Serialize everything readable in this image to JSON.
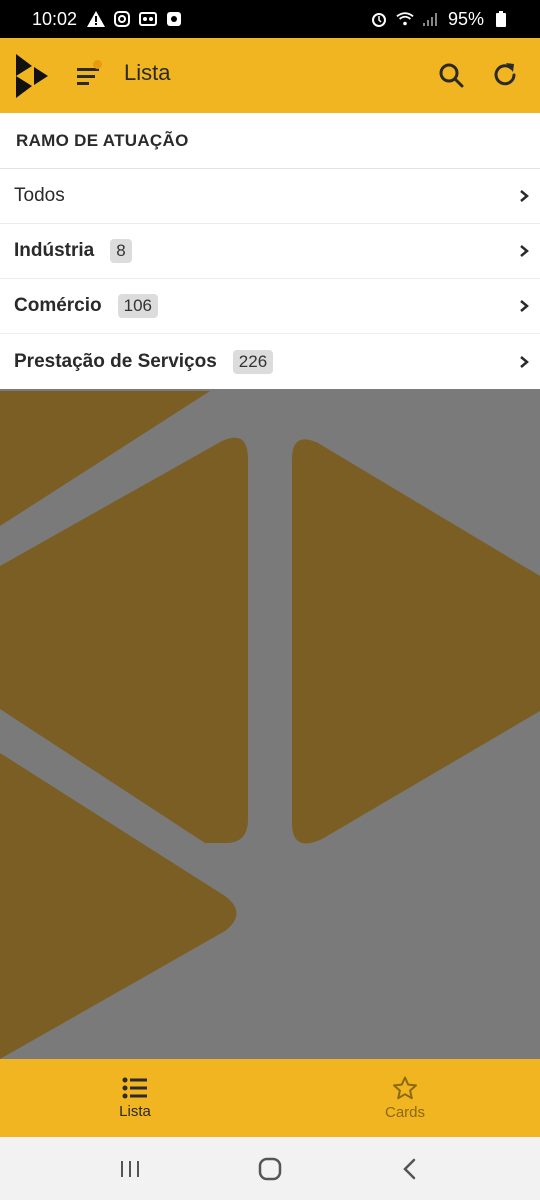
{
  "status_bar": {
    "time": "10:02",
    "battery": "95%"
  },
  "app_bar": {
    "title": "Lista",
    "icons": [
      "logo-icon",
      "menu-icon",
      "search-icon",
      "refresh-icon"
    ]
  },
  "section": {
    "header": "RAMO DE ATUAÇÃO",
    "items": [
      {
        "label": "Todos",
        "count": null
      },
      {
        "label": "Indústria",
        "count": "8"
      },
      {
        "label": "Comércio",
        "count": "106"
      },
      {
        "label": "Prestação de Serviços",
        "count": "226"
      }
    ]
  },
  "bottom_nav": {
    "tabs": [
      {
        "label": "Lista",
        "icon": "list-icon",
        "active": true
      },
      {
        "label": "Cards",
        "icon": "star-icon",
        "active": false
      }
    ]
  },
  "colors": {
    "accent": "#f0b520",
    "overlay": "#7a7a7a",
    "art": "#7a5e24"
  }
}
